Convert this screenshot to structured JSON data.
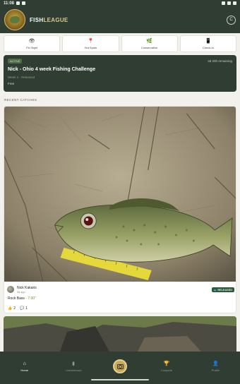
{
  "status_bar": {
    "time": "11:08"
  },
  "header": {
    "brand_part1": "FISH",
    "brand_part2": "LEAGUE",
    "action_icon": "circle-c-icon"
  },
  "quick_actions": [
    {
      "label": "Fin Sight",
      "icon": "eye-icon"
    },
    {
      "label": "Hot Spots",
      "icon": "location-pin-icon"
    },
    {
      "label": "Conservation",
      "icon": "plant-icon"
    },
    {
      "label": "Check-In",
      "icon": "phone-icon"
    }
  ],
  "challenge": {
    "status": "ACTIVE",
    "remaining": "3d 20h remaining",
    "title": "Nick - Ohio 4 week Fishing Challenge",
    "subtitle": "Week 4 · Released",
    "type": "Free"
  },
  "section": {
    "recent_catches": "RECENT CATCHES"
  },
  "catch": {
    "user": "Nick Kakaris",
    "ago": "3d ago",
    "status": "RELEASED",
    "species": "Rock Bass",
    "separator": " - ",
    "length": "7.00\"",
    "likes": "2",
    "comments": "1"
  },
  "nav": {
    "items": [
      {
        "label": "Home",
        "icon": "home-icon",
        "active": true
      },
      {
        "label": "Leaderboard",
        "icon": "bar-chart-icon",
        "active": false
      },
      {
        "label": "Compete",
        "icon": "trophy-icon",
        "active": false
      },
      {
        "label": "Profile",
        "icon": "person-icon",
        "active": false
      }
    ],
    "camera_icon": "camera-icon"
  },
  "colors": {
    "primary_dark": "#2f3d33",
    "accent_gold": "#caa85a",
    "released_green": "#2f5b3d",
    "length_green": "#6e8d3b"
  }
}
